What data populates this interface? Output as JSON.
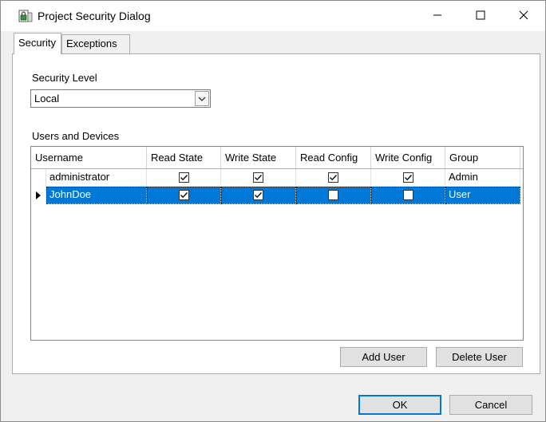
{
  "window": {
    "title": "Project Security Dialog",
    "app_icon": "lock-document-icon",
    "controls": {
      "minimize": "minimize-icon",
      "maximize": "maximize-icon",
      "close": "close-icon"
    }
  },
  "tabs": [
    {
      "label": "Security",
      "active": true
    },
    {
      "label": "Exceptions",
      "active": false
    }
  ],
  "security": {
    "level_label": "Security Level",
    "level_value": "Local"
  },
  "users": {
    "section_label": "Users and Devices",
    "columns": [
      "Username",
      "Read State",
      "Write State",
      "Read Config",
      "Write Config",
      "Group"
    ],
    "rows": [
      {
        "username": "administrator",
        "read_state": true,
        "write_state": true,
        "read_config": true,
        "write_config": true,
        "group": "Admin",
        "selected": false
      },
      {
        "username": "JohnDoe",
        "read_state": true,
        "write_state": true,
        "read_config": false,
        "write_config": false,
        "group": "User",
        "selected": true
      }
    ]
  },
  "buttons": {
    "add_user": "Add User",
    "delete_user": "Delete User",
    "ok": "OK",
    "cancel": "Cancel"
  },
  "colors": {
    "selection": "#0078d7",
    "dialog_bg": "#f0f0f0",
    "panel_bg": "#ffffff"
  }
}
